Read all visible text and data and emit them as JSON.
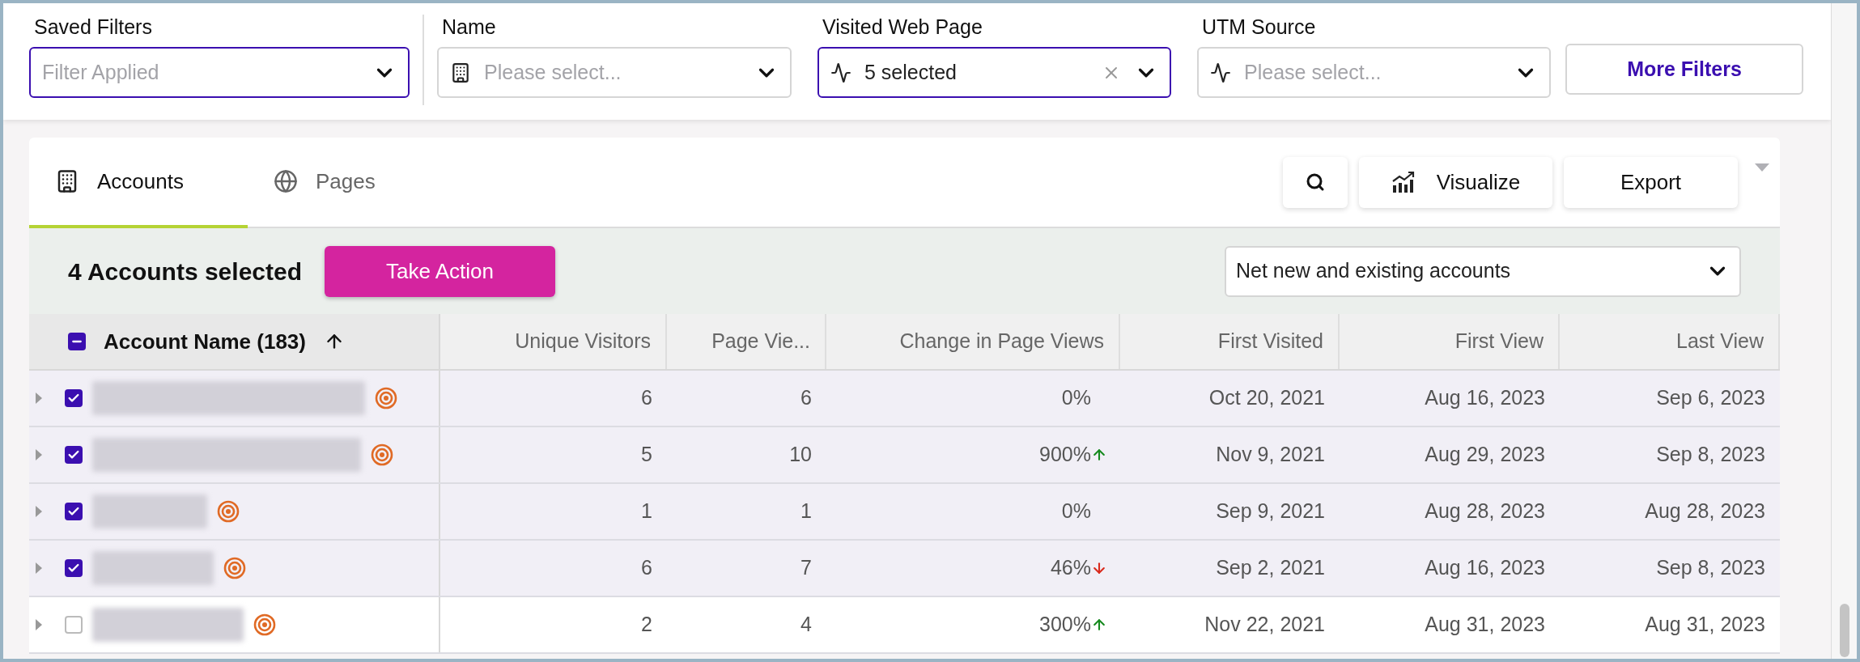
{
  "filters": [
    {
      "kind": "plain",
      "label": "Saved Filters",
      "placeholder": "Filter Applied",
      "focused": true,
      "clearable": false
    },
    {
      "kind": "company",
      "label": "Name",
      "placeholder": "Please select...",
      "focused": false,
      "clearable": false
    },
    {
      "kind": "activity",
      "label": "Visited Web Page",
      "value": "5 selected",
      "focused": true,
      "clearable": true
    },
    {
      "kind": "activity",
      "label": "UTM Source",
      "placeholder": "Please select...",
      "focused": false,
      "clearable": false
    }
  ],
  "more_filters": "More Filters",
  "tabs": [
    {
      "kind": "accounts",
      "label": "Accounts",
      "selected": true
    },
    {
      "kind": "pages",
      "label": "Pages",
      "selected": false
    }
  ],
  "toolbar": [
    {
      "kind": "search"
    },
    {
      "kind": "chart",
      "label": "Visualize"
    },
    {
      "kind": "text",
      "label": "Export"
    }
  ],
  "selection_bar": {
    "summary": "4 Accounts selected",
    "action": "Take Action",
    "scope": "Net new and existing accounts"
  },
  "table": {
    "name_column": {
      "label": "Account Name (183)",
      "sorted_ascending": true,
      "partially_selected": true
    },
    "columns": [
      {
        "label": "Unique Visitors"
      },
      {
        "label": "Page Vie..."
      },
      {
        "label": "Change in Page Views"
      },
      {
        "label": "First Visited"
      },
      {
        "label": "First View"
      },
      {
        "label": "Last View"
      }
    ],
    "rows": [
      {
        "expanded": false,
        "checked": true,
        "cells": [
          "6",
          "6",
          "0%",
          "Oct 20, 2021",
          "Aug 16, 2023",
          "Sep 6, 2023"
        ],
        "rising": false,
        "falling": false
      },
      {
        "expanded": false,
        "checked": true,
        "cells": [
          "5",
          "10",
          "900%",
          "Nov 9, 2021",
          "Aug 29, 2023",
          "Sep 8, 2023"
        ],
        "rising": true,
        "falling": false
      },
      {
        "expanded": false,
        "checked": true,
        "cells": [
          "1",
          "1",
          "0%",
          "Sep 9, 2021",
          "Aug 28, 2023",
          "Aug 28, 2023"
        ],
        "rising": false,
        "falling": false
      },
      {
        "expanded": false,
        "checked": true,
        "cells": [
          "6",
          "7",
          "46%",
          "Sep 2, 2021",
          "Aug 16, 2023",
          "Sep 8, 2023"
        ],
        "rising": false,
        "falling": true
      },
      {
        "expanded": false,
        "checked": false,
        "cells": [
          "2",
          "4",
          "300%",
          "Nov 22, 2021",
          "Aug 31, 2023",
          "Aug 31, 2023"
        ],
        "rising": true,
        "falling": false
      }
    ]
  }
}
